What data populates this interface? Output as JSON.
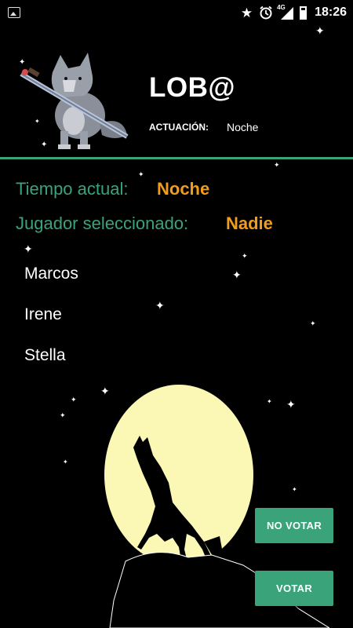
{
  "status_bar": {
    "time": "18:26",
    "network": "4G",
    "icons": [
      "image-icon",
      "star-icon",
      "alarm-icon",
      "signal-icon",
      "battery-icon"
    ]
  },
  "header": {
    "role": "LOB@",
    "acting_label": "ACTUACIÓN:",
    "acting_value": "Noche"
  },
  "game": {
    "time_label": "Tiempo actual:",
    "time_value": "Noche",
    "selected_label": "Jugador seleccionado:",
    "selected_value": "Nadie"
  },
  "players": [
    "Marcos",
    "Irene",
    "Stella"
  ],
  "buttons": {
    "no_vote": "NO VOTAR",
    "vote": "VOTAR"
  },
  "colors": {
    "accent_green": "#3aa37a",
    "accent_orange": "#f39c1b",
    "moon": "#fbf7b4",
    "background": "#000000"
  }
}
